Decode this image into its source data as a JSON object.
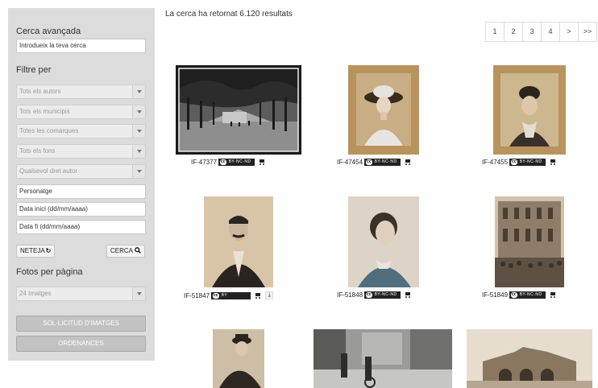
{
  "sidebar": {
    "search_heading": "Cerca avançada",
    "search_placeholder": "Introdueix la teva cerca",
    "filter_heading": "Filtre per",
    "selects": [
      "Tots els autors",
      "Tots els municipis",
      "Totes les comarques",
      "Tots els fons",
      "Qualsevol dret autor"
    ],
    "fields": [
      "Personatge",
      "Data inici (dd/mm/aaaa)",
      "Data fi (dd/mm/aaaa)"
    ],
    "reset_label": "NETEJA",
    "search_label": "CERCA",
    "per_page_heading": "Fotos per pàgina",
    "per_page_value": "24 Imatges",
    "request_button": "SOL·LICITUD D'IMATGES",
    "ordinances_button": "ORDENANCES"
  },
  "main": {
    "result_text": "La cerca ha retornat 6.120 resultats",
    "pagination": [
      "1",
      "2",
      "3",
      "4",
      ">",
      ">>"
    ],
    "photos": [
      {
        "id": "IF-47377",
        "license": "BY-NC-ND",
        "scene": "street"
      },
      {
        "id": "IF-47454",
        "license": "BY-NC-ND",
        "scene": "woman-hat"
      },
      {
        "id": "IF-47455",
        "license": "BY-NC-ND",
        "scene": "woman-updo"
      },
      {
        "id": "IF-51847",
        "license": "BY",
        "scene": "man-mustache",
        "download": true
      },
      {
        "id": "IF-51848",
        "license": "BY-NC-ND",
        "scene": "woman-young"
      },
      {
        "id": "IF-51849",
        "license": "BY-NC-ND",
        "scene": "building-crowd"
      },
      {
        "id": "",
        "license": "",
        "scene": "man-bowler"
      },
      {
        "id": "",
        "license": "",
        "scene": "cyclists"
      },
      {
        "id": "",
        "license": "",
        "scene": "ruin"
      }
    ],
    "cc_mark": "cc"
  },
  "colors": {
    "sidebar_bg": "#dcdcdc",
    "button_grey": "#c2c2c2",
    "sepia": "#b79460"
  },
  "icons": {
    "reset": "refresh-icon",
    "search": "search-icon",
    "cart": "cart-icon",
    "download": "download-icon",
    "select_arrow": "chevron-down-icon"
  }
}
